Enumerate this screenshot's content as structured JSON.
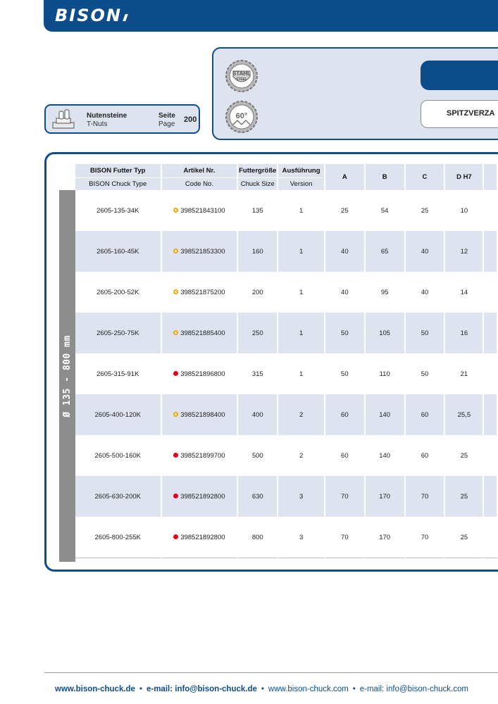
{
  "brand": {
    "logo_text": "BISON"
  },
  "tnut_ref": {
    "title": "Nutensteine",
    "subtitle": "T-Nuts",
    "seite_label": "Seite",
    "page_label": "Page",
    "page_number": "200"
  },
  "product": {
    "badges": [
      {
        "icon": "steel-gear-badge-icon",
        "top": "STAHL",
        "bottom": "STEEL"
      },
      {
        "icon": "sixty-degree-gear-badge-icon",
        "text": "60°"
      }
    ],
    "subtitle": "SPITZVERZA"
  },
  "table": {
    "side_label": "Ø 135 - 800 mm",
    "headers_de": [
      "BISON Futter Typ",
      "Artikel Nr.",
      "Futtergröße",
      "Ausführung",
      "A",
      "B",
      "C",
      "D H7"
    ],
    "headers_en": [
      "BISON Chuck Type",
      "Code No.",
      "Chuck Size",
      "Version"
    ],
    "rows": [
      {
        "typ": "2605-135-34K",
        "code": "398521843100",
        "marker": "ring",
        "size": "135",
        "version": "1",
        "a": "25",
        "b": "54",
        "c": "25",
        "d": "10"
      },
      {
        "typ": "2605-160-45K",
        "code": "398521853300",
        "marker": "ring",
        "size": "160",
        "version": "1",
        "a": "40",
        "b": "65",
        "c": "40",
        "d": "12"
      },
      {
        "typ": "2605-200-52K",
        "code": "398521875200",
        "marker": "ring",
        "size": "200",
        "version": "1",
        "a": "40",
        "b": "95",
        "c": "40",
        "d": "14"
      },
      {
        "typ": "2605-250-75K",
        "code": "398521885400",
        "marker": "ring",
        "size": "250",
        "version": "1",
        "a": "50",
        "b": "105",
        "c": "50",
        "d": "16"
      },
      {
        "typ": "2605-315-91K",
        "code": "398521896800",
        "marker": "filled",
        "size": "315",
        "version": "1",
        "a": "50",
        "b": "110",
        "c": "50",
        "d": "21"
      },
      {
        "typ": "2605-400-120K",
        "code": "398521898400",
        "marker": "ring",
        "size": "400",
        "version": "2",
        "a": "60",
        "b": "140",
        "c": "60",
        "d": "25,5"
      },
      {
        "typ": "2605-500-160K",
        "code": "398521899700",
        "marker": "filled",
        "size": "500",
        "version": "2",
        "a": "60",
        "b": "140",
        "c": "60",
        "d": "25"
      },
      {
        "typ": "2605-630-200K",
        "code": "398521892800",
        "marker": "filled",
        "size": "630",
        "version": "3",
        "a": "70",
        "b": "170",
        "c": "70",
        "d": "25"
      },
      {
        "typ": "2605-800-255K",
        "code": "398521892800",
        "marker": "filled",
        "size": "800",
        "version": "3",
        "a": "70",
        "b": "170",
        "c": "70",
        "d": "25"
      }
    ]
  },
  "footer": {
    "web_de": "www.bison-chuck.de",
    "mail_de": "e-mail: info@bison-chuck.de",
    "web_com": "www.bison-chuck.com",
    "mail_com": "e-mail: info@bison-chuck.com",
    "separator": "•"
  },
  "colors": {
    "brand_blue": "#0e4d8c",
    "row_shade": "#dde3ef",
    "ring_marker": "#f5a500",
    "filled_marker": "#e0001b",
    "side_bar": "#8d8d8d"
  }
}
